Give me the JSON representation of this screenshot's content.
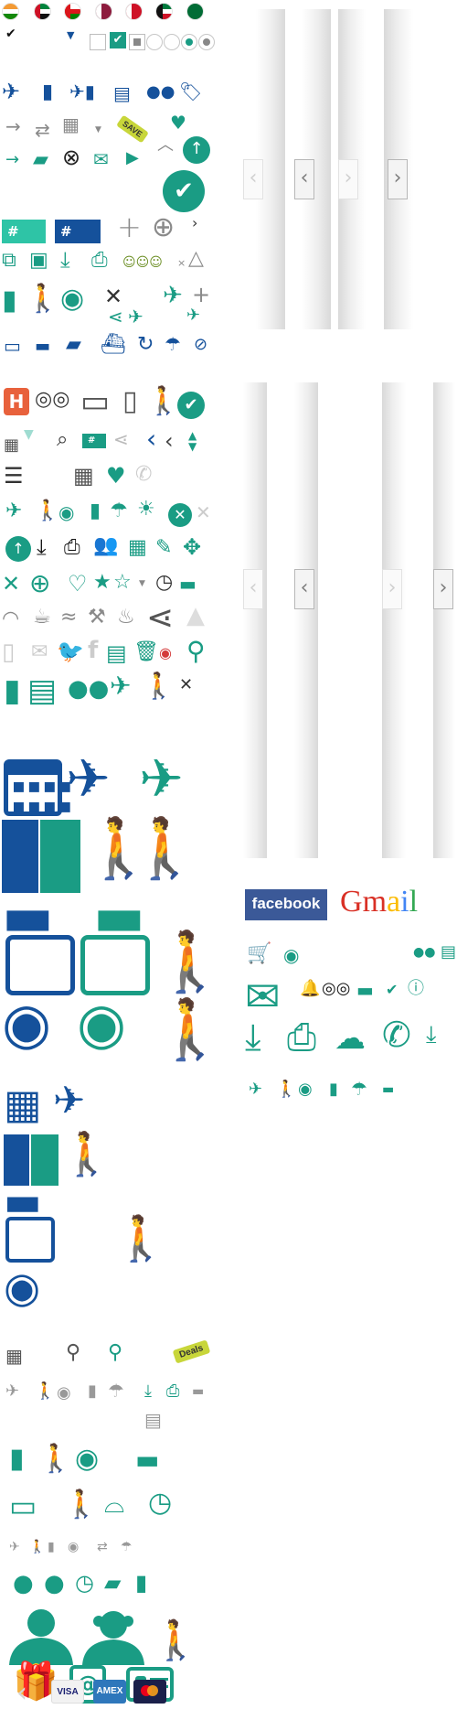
{
  "sprites": {
    "check_mark": "✔",
    "save_tag": "SAVE",
    "hash_tag": "#",
    "facebook": "facebook",
    "gmail_letters": [
      "G",
      "m",
      "a",
      "i",
      "l"
    ],
    "deals_tag": "Deals"
  },
  "payment_cards": {
    "visa": "VISA",
    "amex": "AMEX",
    "mastercard": "MC"
  },
  "colors": {
    "teal": "#1a9c84",
    "blue": "#15519b",
    "gray": "#8a8a8a",
    "facebook_blue": "#3b5998"
  },
  "icons": [
    "airplane-icon",
    "hotel-icon",
    "hiker-icon",
    "dining-icon",
    "bus-icon",
    "car-icon",
    "walker-icon",
    "calendar-icon",
    "binoculars-icon",
    "map-icon",
    "umbrella-icon",
    "tripadvisor-icon",
    "printer-icon",
    "download-icon",
    "mail-icon",
    "phone-icon",
    "share-icon",
    "heart-icon",
    "star-icon",
    "wifi-icon",
    "coffee-icon",
    "pool-icon",
    "gym-icon",
    "bath-icon",
    "user-icon",
    "gift-icon",
    "contact-card-icon",
    "luggage-traveler-icon"
  ]
}
